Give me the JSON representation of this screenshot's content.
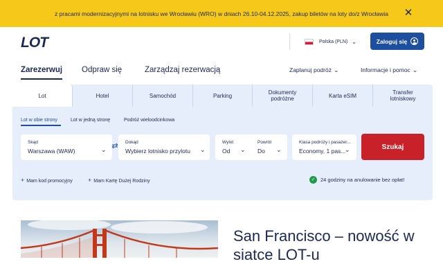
{
  "banner": {
    "text": "z pracami modernizacyjnymi na lotnisku we Wrocławiu (WRO) w dniach 26.10-04.12.2025, zakup biletów na loty do/z Wrocławia",
    "close": "✕"
  },
  "header": {
    "logo": "LOT",
    "language": "Polska (PLN)",
    "login": "Zaloguj się"
  },
  "nav": {
    "items": [
      "Zarezerwuj",
      "Odpraw się",
      "Zarządzaj rezerwacją"
    ],
    "right": [
      "Zaplanuj podróż",
      "Informacje i pomoc"
    ]
  },
  "tabs": [
    {
      "l1": "Lot",
      "l2": ""
    },
    {
      "l1": "Hotel",
      "l2": ""
    },
    {
      "l1": "Samochód",
      "l2": ""
    },
    {
      "l1": "Parking",
      "l2": ""
    },
    {
      "l1": "Dokumenty",
      "l2": "podróżne"
    },
    {
      "l1": "Karta eSIM",
      "l2": ""
    },
    {
      "l1": "Transfer",
      "l2": "lotniskowy"
    }
  ],
  "trip_types": [
    "Lot w obie strony",
    "Lot w jedną stronę",
    "Podróż wieloodcinkowa"
  ],
  "form": {
    "from_label": "Skąd",
    "from_value": "Warszawa (WAW)",
    "to_label": "Dokąd",
    "to_value": "Wybierz lotnisko przylotu",
    "depart_label": "Wylot",
    "depart_value": "Od",
    "return_label": "Powrót",
    "return_value": "Do",
    "class_label": "Klasa podróży i pasażer...",
    "class_value": "Economy, 1 pas...",
    "search": "Szukaj"
  },
  "links": {
    "promo": "Mam kod promocyjny",
    "family": "Mam Kartę Dużej Rodziny"
  },
  "guarantee": "24 godziny na anulowanie bez opłat!",
  "promo": {
    "title": "San Francisco – nowość w siatce LOT-u"
  },
  "colors": {
    "banner": "#f6c81a",
    "primary": "#1d4ea0",
    "search": "#c9212a",
    "panel": "#e6eefb",
    "navy": "#1b2a55"
  }
}
